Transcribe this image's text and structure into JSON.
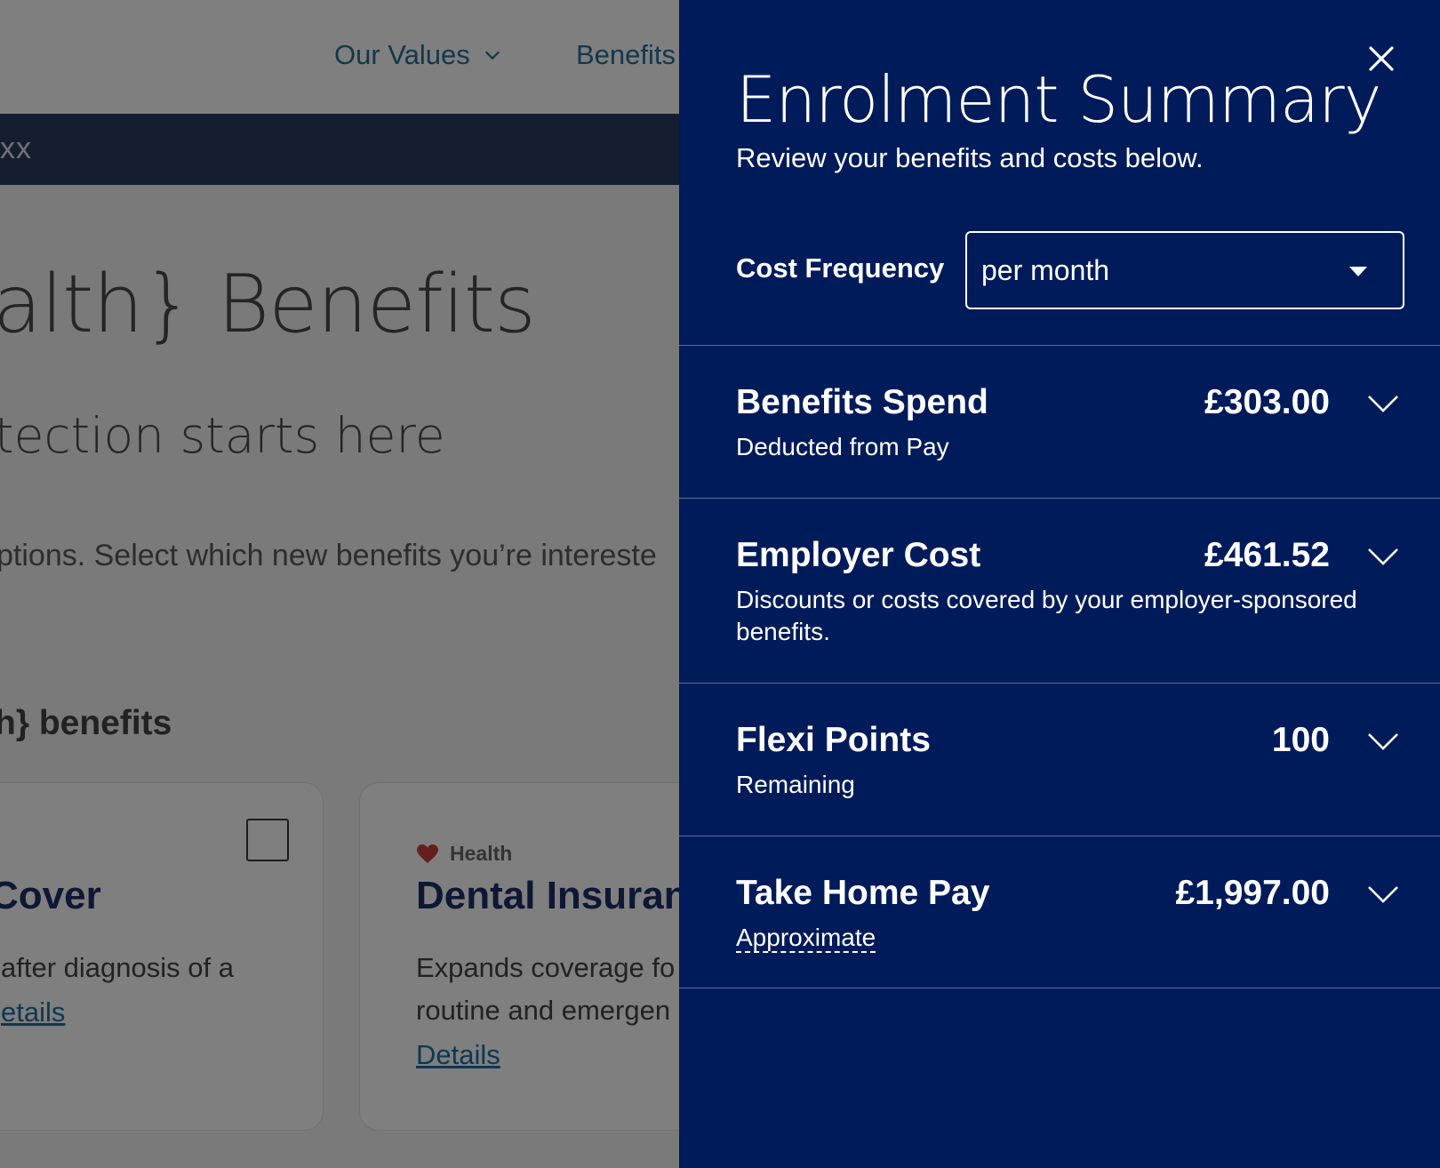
{
  "background": {
    "nav": {
      "our_values": "Our Values",
      "benefits": "Benefits"
    },
    "banner_text": "xx",
    "hero_title": "alth} Benefits",
    "hero_subtitle": "tection starts here",
    "hero_description": "ptions. Select which new benefits you’re intereste",
    "section_heading": "h} benefits",
    "cards": [
      {
        "title": "Cover",
        "description": "after diagnosis of a",
        "link": "etails"
      },
      {
        "tag": "Health",
        "title": "Dental Insuran",
        "description_line1": "Expands coverage fo",
        "description_line2": "routine and emergen",
        "link": "Details"
      }
    ]
  },
  "drawer": {
    "title": "Enrolment Summary",
    "subtitle": "Review your benefits and costs below.",
    "cost_frequency": {
      "label": "Cost Frequency",
      "selected": "per month"
    },
    "rows": [
      {
        "title": "Benefits Spend",
        "amount": "£303.00",
        "description": "Deducted from Pay"
      },
      {
        "title": "Employer Cost",
        "amount": "£461.52",
        "description": "Discounts or costs covered by your employer-sponsored benefits."
      },
      {
        "title": "Flexi Points",
        "amount": "100",
        "description": "Remaining"
      },
      {
        "title": "Take Home Pay",
        "amount": "£1,997.00",
        "description": "Approximate"
      }
    ]
  },
  "colors": {
    "drawer_bg": "#001b5a",
    "card_title": "#1d2f6a",
    "link": "#1f6fa4",
    "heart": "#c8403a"
  },
  "icons": [
    "chevron-down-icon",
    "close-icon",
    "heart-icon",
    "caret-down-icon"
  ]
}
